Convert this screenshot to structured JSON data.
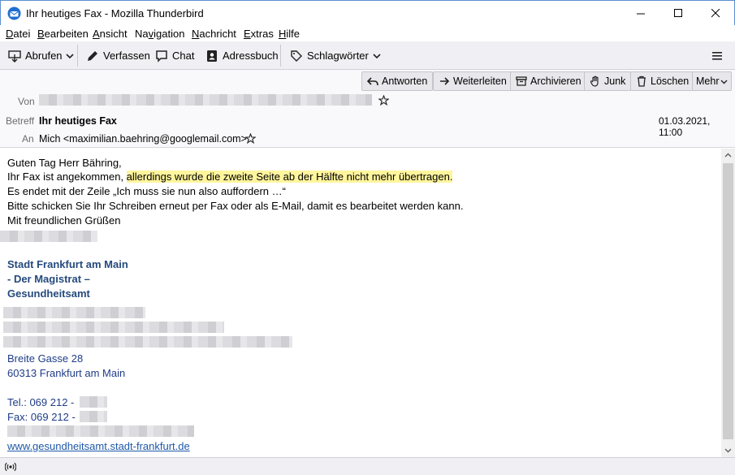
{
  "window": {
    "title": "Ihr heutiges Fax - Mozilla Thunderbird",
    "accent": "#5a8fd0"
  },
  "menu": [
    "Datei",
    "Bearbeiten",
    "Ansicht",
    "Navigation",
    "Nachricht",
    "Extras",
    "Hilfe"
  ],
  "menu_underline": [
    "D",
    "B",
    "A",
    "v",
    "N",
    "E",
    "H"
  ],
  "toolbar": {
    "get_mail": "Abrufen",
    "write": "Verfassen",
    "chat": "Chat",
    "address_book": "Adressbuch",
    "tags": "Schlagwörter"
  },
  "header_actions": {
    "reply": "Antworten",
    "forward": "Weiterleiten",
    "archive": "Archivieren",
    "junk": "Junk",
    "delete": "Löschen",
    "more": "Mehr"
  },
  "header": {
    "from_label": "Von",
    "subject_label": "Betreff",
    "subject": "Ihr heutiges Fax",
    "to_label": "An",
    "to": "Mich <maximilian.baehring@googlemail.com>",
    "date": "01.03.2021, 11:00"
  },
  "body": {
    "greeting": "Guten Tag Herr Bähring,",
    "line2_pre": "Ihr Fax ist angekommen, ",
    "line2_highlight": "allerdings wurde die zweite Seite ab der Hälfte nicht mehr übertragen.",
    "line3": "Es endet mit der Zeile „Ich muss sie nun also auffordern …“",
    "line4": "Bitte schicken Sie Ihr Schreiben erneut per Fax oder als E-Mail, damit es bearbeitet werden kann.",
    "line5": "Mit freundlichen Grüßen"
  },
  "signature": {
    "org1": "Stadt Frankfurt am Main",
    "org2": "- Der Magistrat –",
    "org3": "Gesundheitsamt",
    "street": "Breite Gasse 28",
    "city": "60313 Frankfurt am Main",
    "tel": "Tel.: 069 212 -",
    "fax": "Fax: 069 212 -",
    "website": "www.gesundheitsamt.stadt-frankfurt.de"
  }
}
